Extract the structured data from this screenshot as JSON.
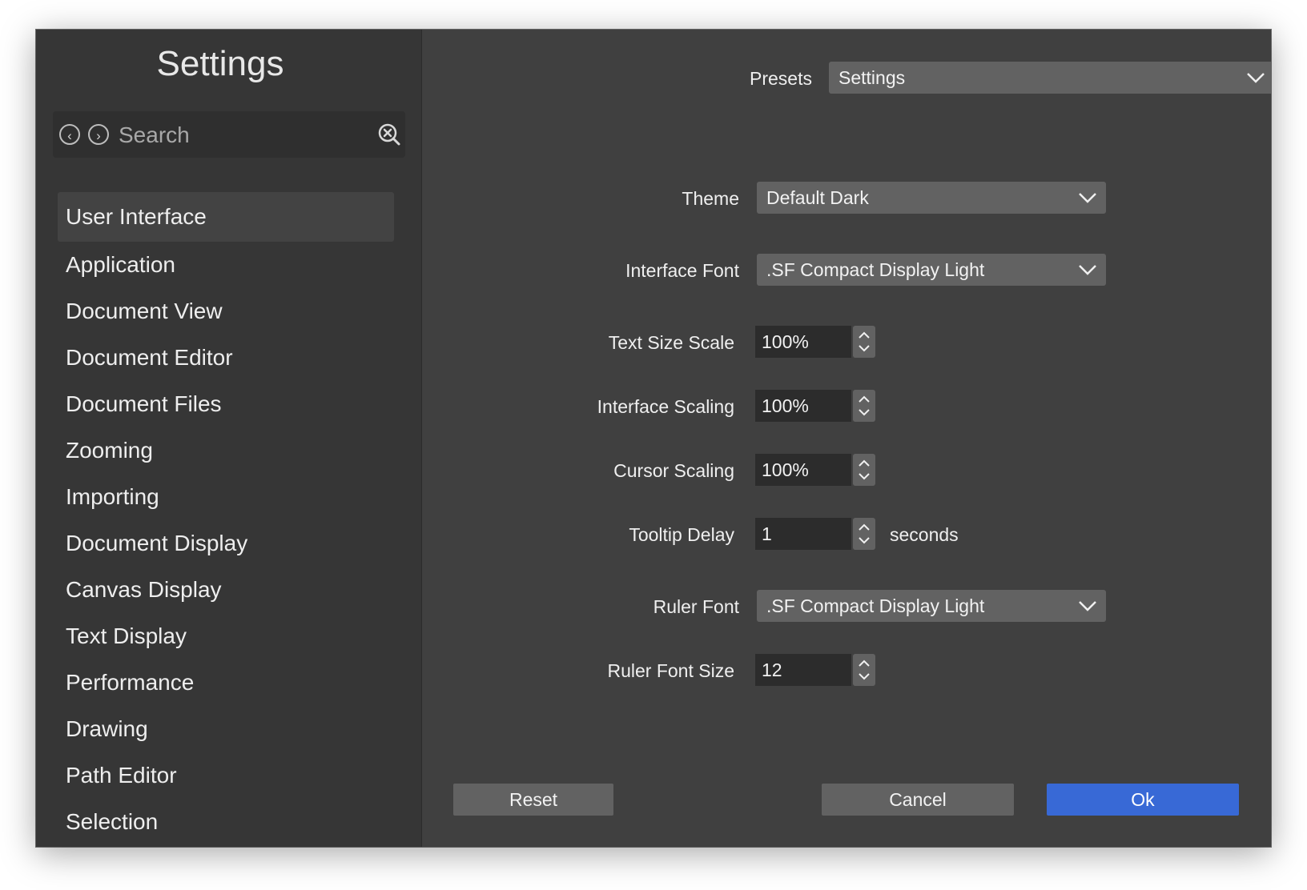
{
  "sidebar": {
    "title": "Settings",
    "search_placeholder": "Search",
    "items": [
      {
        "label": "User Interface",
        "active": true
      },
      {
        "label": "Application"
      },
      {
        "label": "Document View"
      },
      {
        "label": "Document Editor"
      },
      {
        "label": "Document Files"
      },
      {
        "label": "Zooming"
      },
      {
        "label": "Importing"
      },
      {
        "label": "Document Display"
      },
      {
        "label": "Canvas Display"
      },
      {
        "label": "Text Display"
      },
      {
        "label": "Performance"
      },
      {
        "label": "Drawing"
      },
      {
        "label": "Path Editor"
      },
      {
        "label": "Selection"
      }
    ]
  },
  "presets": {
    "label": "Presets",
    "value": "Settings"
  },
  "settings": {
    "theme": {
      "label": "Theme",
      "value": "Default Dark"
    },
    "interface_font": {
      "label": "Interface Font",
      "value": ".SF Compact Display Light"
    },
    "text_size_scale": {
      "label": "Text Size Scale",
      "value": "100%"
    },
    "interface_scaling": {
      "label": "Interface Scaling",
      "value": "100%"
    },
    "cursor_scaling": {
      "label": "Cursor Scaling",
      "value": "100%"
    },
    "tooltip_delay": {
      "label": "Tooltip Delay",
      "value": "1",
      "unit": "seconds"
    },
    "ruler_font": {
      "label": "Ruler Font",
      "value": ".SF Compact Display Light"
    },
    "ruler_font_size": {
      "label": "Ruler Font Size",
      "value": "12"
    }
  },
  "buttons": {
    "reset": "Reset",
    "cancel": "Cancel",
    "ok": "Ok"
  },
  "colors": {
    "accent": "#3869d6",
    "panel": "#404040",
    "sidebar": "#363636",
    "control": "#626262"
  },
  "icons": {
    "back": "chevron-left-circle-icon",
    "forward": "chevron-right-circle-icon",
    "search": "search-clear-icon",
    "dropdown": "chevron-down-icon",
    "stepper": "stepper-arrows-icon"
  }
}
